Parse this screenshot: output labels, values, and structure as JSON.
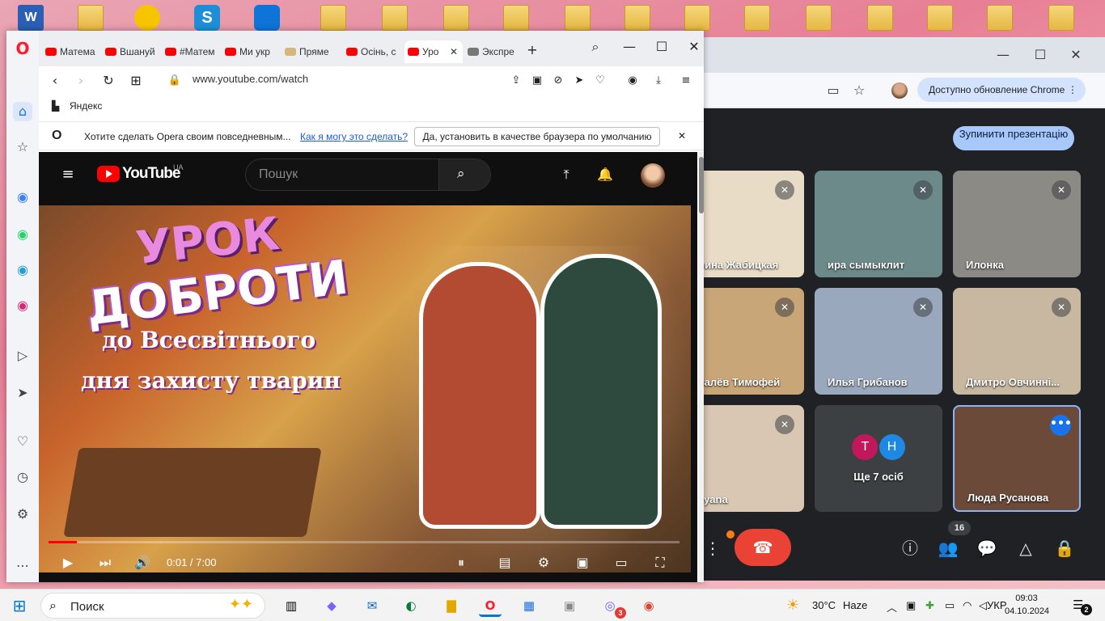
{
  "desktop": {
    "icons": [
      "word-doc-icon",
      "folder-icon",
      "archive-icon",
      "skype-icon",
      "teamviewer-icon",
      "folder-icon",
      "folder-icon",
      "folder-icon",
      "folder-icon",
      "folder-icon",
      "folder-icon",
      "folder-icon",
      "folder-icon",
      "folder-icon",
      "folder-icon",
      "folder-icon",
      "folder-icon",
      "folder-icon"
    ]
  },
  "chrome": {
    "update_label": "Доступно обновление Chrome",
    "stop_presenting": "Зупинити презентацію",
    "participants": [
      {
        "name": "...лина Жабицкая",
        "muted": true,
        "bg": "#e8dcc6"
      },
      {
        "name": "ира сымыклит",
        "muted": true,
        "bg": "#6d8a8a"
      },
      {
        "name": "Илонка",
        "muted": true,
        "bg": "#8c8a84"
      },
      {
        "name": "...валёв Тимофей",
        "muted": true,
        "bg": "#c9a678"
      },
      {
        "name": "Илья Грибанов",
        "muted": true,
        "bg": "#9aa8bd"
      },
      {
        "name": "Дмитро Овчинні...",
        "muted": true,
        "bg": "#c8b8a2"
      },
      {
        "name": "...ayana",
        "muted": true,
        "bg": "#d9c7b4"
      },
      {
        "name": "Ще 7 осіб",
        "muted": false,
        "bg": "#3c4043"
      },
      {
        "name": "Люда Русанова",
        "muted": false,
        "bg": "#6b4a3a"
      }
    ],
    "more_avatars": [
      {
        "letter": "Т",
        "color": "#c2185b"
      },
      {
        "letter": "Н",
        "color": "#1e88e5"
      }
    ],
    "participant_count": "16"
  },
  "opera": {
    "tabs": [
      "Матема",
      "Вшануй",
      "#Матем",
      "Ми укр",
      "Пряме",
      "Осінь, с",
      "Уро",
      "Экспре"
    ],
    "active_tab": 6,
    "url": "www.youtube.com/watch",
    "bookmark": "Яндекс",
    "notice_text": "Хотите сделать Opera своим повседневным...",
    "notice_link": "Как я могу это сделать?",
    "notice_button": "Да, установить в качестве браузера по умолчанию"
  },
  "youtube": {
    "logo_text": "YouTube",
    "region": "UA",
    "search_placeholder": "Пошук",
    "video": {
      "title_line1": "УРОК",
      "title_line2": "ДОБРОТИ",
      "subtitle_line1": "до Всесвітнього",
      "subtitle_line2": "дня захисту тварин",
      "time": "0:01 / 7:00",
      "progress": 0.0024
    }
  },
  "taskbar": {
    "search_placeholder": "Поиск",
    "weather_temp": "30°C",
    "weather_desc": "Haze",
    "lang": "УКР",
    "time": "09:03",
    "date": "04.10.2024",
    "notification_count": "2",
    "viber_badge": "3"
  },
  "colors": {
    "youtube_red": "#ff0000",
    "opera_red": "#ff1b2d",
    "meet_hangup": "#ea4335",
    "meet_blue": "#1a73e8",
    "meet_button": "#a8c7fa"
  }
}
